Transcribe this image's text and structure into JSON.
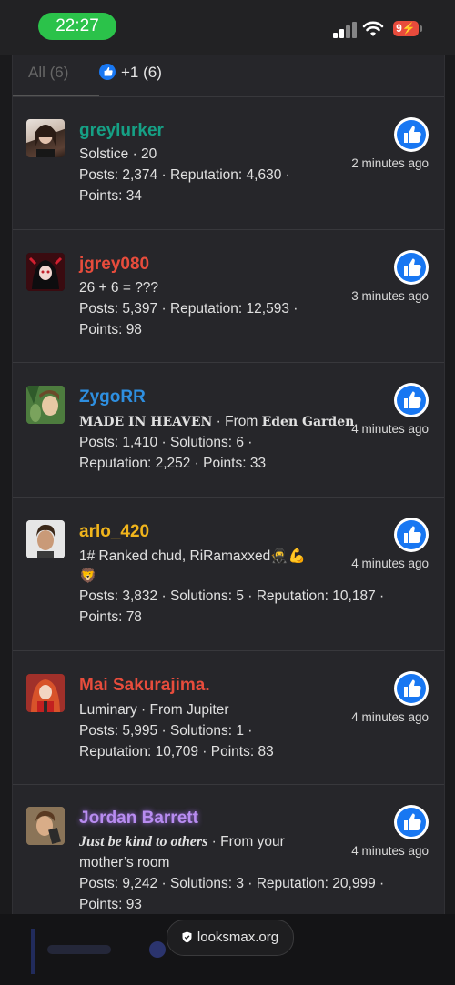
{
  "status_bar": {
    "time": "22:27",
    "battery": "9"
  },
  "tabs": {
    "all_label": "All (6)",
    "like_label": "+1 (6)"
  },
  "colors": {
    "accent_like": "#1877f2",
    "time_pill": "#2bc24a"
  },
  "reactions": [
    {
      "username": "greylurker",
      "name_color": "#16a085",
      "line1": "Solstice · 20",
      "line2": "Posts: 2,374 · Reputation: 4,630 ·",
      "line3": "Points: 34",
      "time": "2 minutes ago"
    },
    {
      "username": "jgrey080",
      "name_color": "#e74c3c",
      "line1": "26 + 6 = ???",
      "line2": "Posts: 5,397 · Reputation: 12,593 ·",
      "line3": "Points: 98",
      "time": "3 minutes ago"
    },
    {
      "username": "ZygoRR",
      "name_color": "#2e8fe0",
      "title": "MADE IN HEAVEN",
      "from_prefix": " · From ",
      "from": "Eden Garden",
      "line2": "Posts: 1,410 · Solutions: 6 ·",
      "line3": "Reputation: 2,252 · Points: 33",
      "time": "4 minutes ago"
    },
    {
      "username": "arlo_420",
      "name_color": "#f1b51c",
      "line1": "1# Ranked chud, RiRamaxxed🥷💪",
      "line1b": "🦁",
      "line2": "Posts: 3,832 · Solutions: 5 · Reputation: 10,187 ·",
      "line3": "Points: 78",
      "time": "4 minutes ago"
    },
    {
      "username": "Mai Sakurajima.",
      "name_color": "#e74c3c",
      "line1": "Luminary · From Jupiter",
      "line2": "Posts: 5,995 · Solutions: 1 ·",
      "line3": "Reputation: 10,709 · Points: 83",
      "time": "4 minutes ago"
    },
    {
      "username": "Jordan Barrett",
      "name_color": "#b88cf0",
      "title": "Just be kind to others",
      "from_suffix": " · From your",
      "line1b": "mother’s room",
      "line2": "Posts: 9,242 · Solutions: 3 · Reputation: 20,999 ·",
      "line3": "Points: 93",
      "time": "4 minutes ago"
    }
  ],
  "bottom": {
    "url": "looksmax.org"
  }
}
